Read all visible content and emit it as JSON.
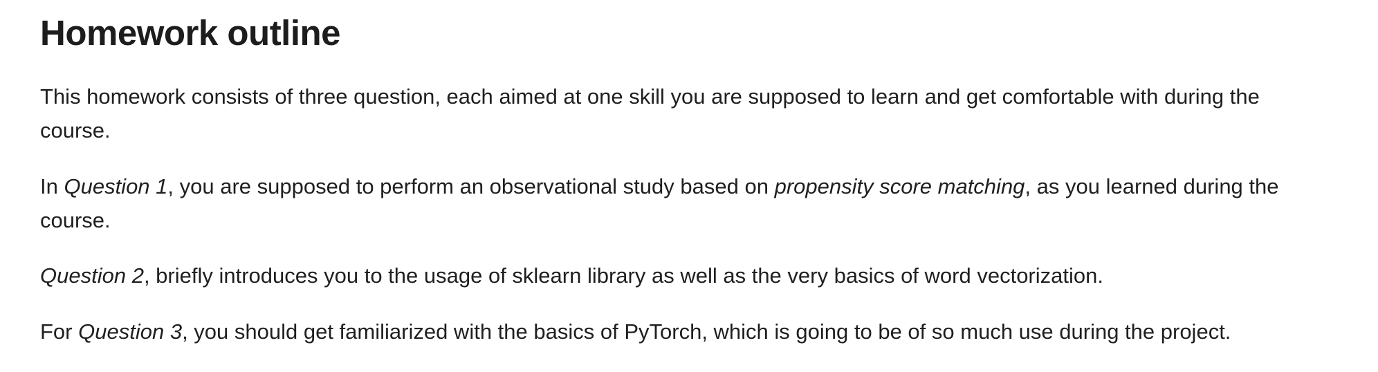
{
  "heading": "Homework outline",
  "paragraphs": {
    "p1": {
      "text_a": "This homework consists of three question, each aimed at one skill you are supposed to learn and get comfortable with during the",
      "text_b": "course."
    },
    "p2": {
      "text_a": "In ",
      "em_1": "Question 1",
      "text_b": ", you are supposed to perform an observational study based on ",
      "em_2": "propensity score matching",
      "text_c": ", as you learned during the",
      "text_d": "course."
    },
    "p3": {
      "em_1": "Question 2",
      "text_a": ", briefly introduces you to the usage of sklearn library as well as the very basics of word vectorization."
    },
    "p4": {
      "text_a": "For ",
      "em_1": "Question 3",
      "text_b": ", you should get familiarized with the basics of PyTorch, which is going to be of so much use during the project."
    }
  }
}
